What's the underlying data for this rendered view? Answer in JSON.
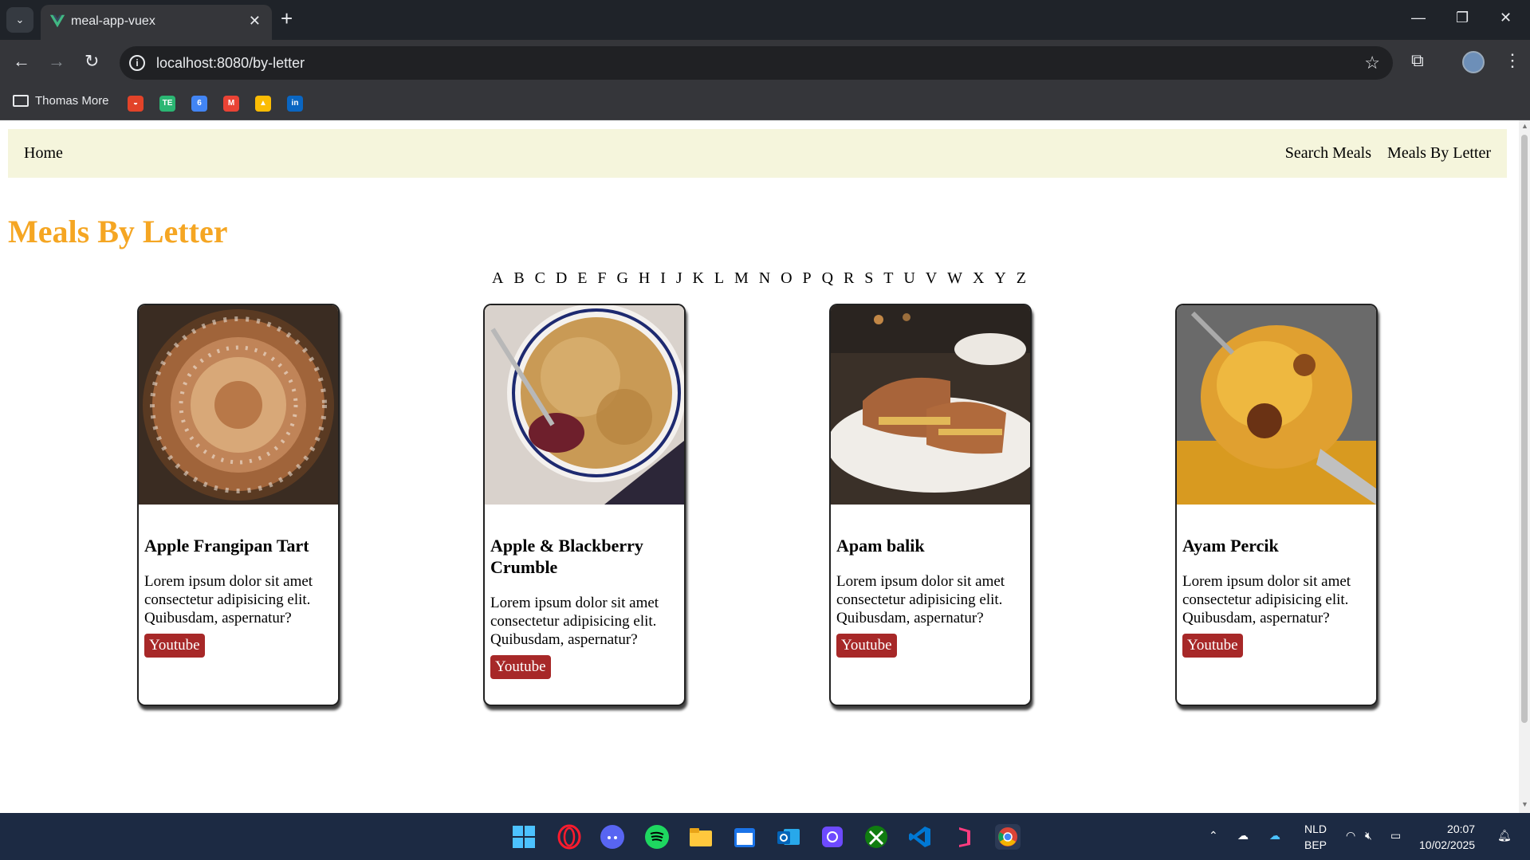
{
  "browser": {
    "tab_title": "meal-app-vuex",
    "url": "localhost:8080/by-letter",
    "bookmark_folder": "Thomas More",
    "bookmarks": [
      {
        "name": "gitlab",
        "color": "#e24329",
        "glyph": "◒"
      },
      {
        "name": "te",
        "color": "#2bb673",
        "glyph": "TE"
      },
      {
        "name": "calendar",
        "color": "#4285f4",
        "glyph": "6"
      },
      {
        "name": "gmail",
        "color": "#ea4335",
        "glyph": "M"
      },
      {
        "name": "drive",
        "color": "#fbbc04",
        "glyph": "▲"
      },
      {
        "name": "linkedin",
        "color": "#0a66c2",
        "glyph": "in"
      }
    ]
  },
  "app": {
    "nav": {
      "home": "Home",
      "search": "Search Meals",
      "by_letter": "Meals By Letter"
    },
    "title": "Meals By Letter",
    "letters": [
      "A",
      "B",
      "C",
      "D",
      "E",
      "F",
      "G",
      "H",
      "I",
      "J",
      "K",
      "L",
      "M",
      "N",
      "O",
      "P",
      "Q",
      "R",
      "S",
      "T",
      "U",
      "V",
      "W",
      "X",
      "Y",
      "Z"
    ],
    "meals": [
      {
        "name": "Apple Frangipan Tart",
        "description": "Lorem ipsum dolor sit amet consectetur adipisicing elit. Quibusdam, aspernatur?",
        "button": "Youtube"
      },
      {
        "name": "Apple & Blackberry Crumble",
        "description": "Lorem ipsum dolor sit amet consectetur adipisicing elit. Quibusdam, aspernatur?",
        "button": "Youtube"
      },
      {
        "name": "Apam balik",
        "description": "Lorem ipsum dolor sit amet consectetur adipisicing elit. Quibusdam, aspernatur?",
        "button": "Youtube"
      },
      {
        "name": "Ayam Percik",
        "description": "Lorem ipsum dolor sit amet consectetur adipisicing elit. Quibusdam, aspernatur?",
        "button": "Youtube"
      }
    ],
    "colors": {
      "title": "#f5a623",
      "nav_bg": "#f5f5dc",
      "button": "#a72828"
    }
  },
  "taskbar": {
    "language": "NLD",
    "keyboard": "BEP",
    "time": "20:07",
    "date": "10/02/2025"
  }
}
